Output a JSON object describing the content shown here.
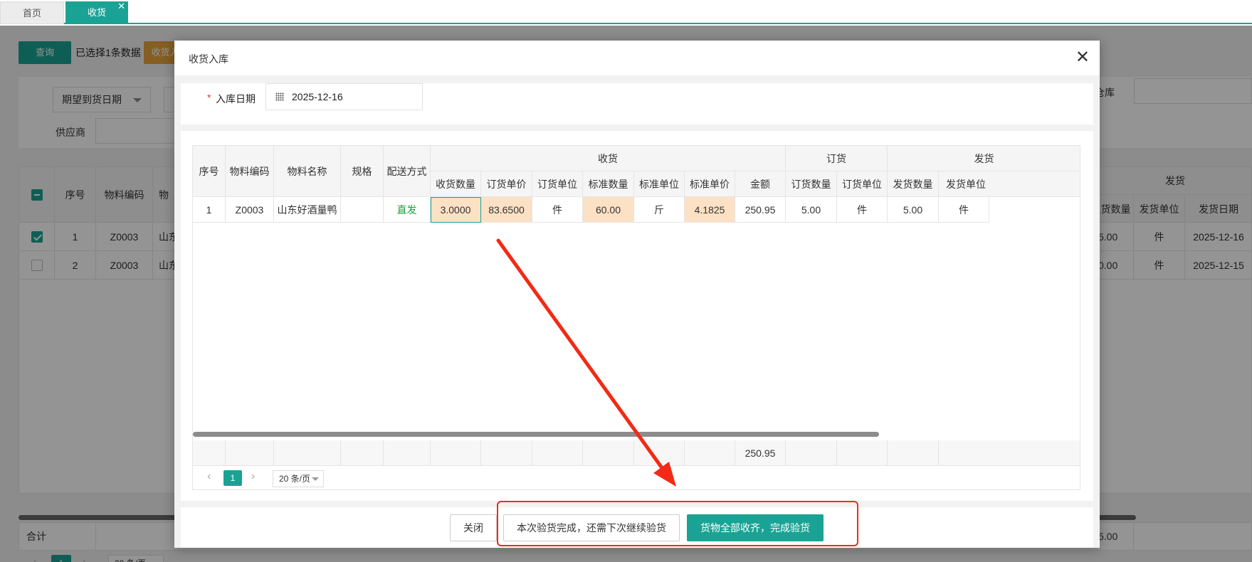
{
  "tabs": [
    {
      "label": "首页",
      "active": false
    },
    {
      "label": "收货",
      "active": true,
      "close_glyph": "✕"
    }
  ],
  "background": {
    "query_button": "查询",
    "selected_text": "已选择1条数据",
    "receive_button": "收货入",
    "filter_select": "期望到货日期",
    "supplier_label": "供应商",
    "warehouse_label": "仓库",
    "table_headers": [
      "序号",
      "物料编码",
      "物",
      "货数量",
      "发货单位",
      "发货日期"
    ],
    "group_header": "发货",
    "rows": [
      {
        "checked": true,
        "index": "1",
        "code": "Z0003",
        "name": "山东",
        "qty": "5.00",
        "unit": "件",
        "date": "2025-12-16"
      },
      {
        "checked": false,
        "index": "2",
        "code": "Z0003",
        "name": "山东",
        "qty": "0.00",
        "unit": "件",
        "date": "2025-12-15"
      }
    ],
    "total_label": "合计",
    "total_value": "5.00",
    "page": "1",
    "page_size": "20 条/页"
  },
  "modal": {
    "title": "收货入库",
    "close_glyph": "✕",
    "date_label": "入库日期",
    "required_mark": "*",
    "date_value": "2025-12-16",
    "groups": [
      "收货",
      "订货",
      "发货"
    ],
    "fixed_headers": [
      "序号",
      "物料编码",
      "物料名称",
      "规格",
      "配送方式"
    ],
    "sub_headers": [
      "收货数量",
      "订货单价",
      "订货单位",
      "标准数量",
      "标准单位",
      "标准单价",
      "金额",
      "订货数量",
      "订货单位",
      "发货数量",
      "发货单位"
    ],
    "row": [
      "1",
      "Z0003",
      "山东好酒量鸭",
      "",
      "直发",
      "3.0000",
      "83.6500",
      "件",
      "60.00",
      "斤",
      "4.1825",
      "250.95",
      "5.00",
      "件",
      "5.00",
      "件"
    ],
    "sum_amount": "250.95",
    "pager": {
      "page": "1",
      "page_size": "20 条/页",
      "prev": "‹",
      "next": "›"
    },
    "buttons": {
      "close": "关闭",
      "partial": "本次验货完成，还需下次继续验货",
      "complete": "货物全部收齐，完成验货"
    }
  },
  "colors": {
    "primary": "#1aa394",
    "edit_cell": "#fde1c4",
    "annotation": "#f22a16",
    "delivery_text": "#1a9e3a"
  }
}
